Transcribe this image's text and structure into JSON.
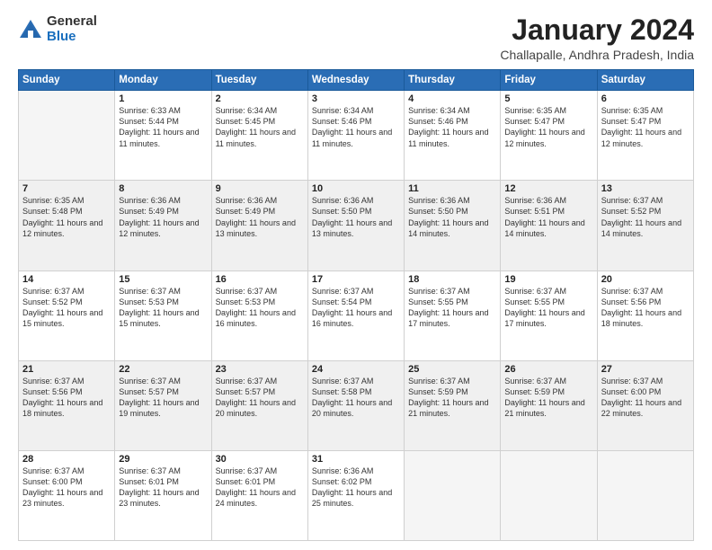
{
  "logo": {
    "general": "General",
    "blue": "Blue"
  },
  "header": {
    "month_year": "January 2024",
    "location": "Challapalle, Andhra Pradesh, India"
  },
  "days_of_week": [
    "Sunday",
    "Monday",
    "Tuesday",
    "Wednesday",
    "Thursday",
    "Friday",
    "Saturday"
  ],
  "weeks": [
    [
      {
        "day": "",
        "sunrise": "",
        "sunset": "",
        "daylight": "",
        "empty": true
      },
      {
        "day": "1",
        "sunrise": "Sunrise: 6:33 AM",
        "sunset": "Sunset: 5:44 PM",
        "daylight": "Daylight: 11 hours and 11 minutes."
      },
      {
        "day": "2",
        "sunrise": "Sunrise: 6:34 AM",
        "sunset": "Sunset: 5:45 PM",
        "daylight": "Daylight: 11 hours and 11 minutes."
      },
      {
        "day": "3",
        "sunrise": "Sunrise: 6:34 AM",
        "sunset": "Sunset: 5:46 PM",
        "daylight": "Daylight: 11 hours and 11 minutes."
      },
      {
        "day": "4",
        "sunrise": "Sunrise: 6:34 AM",
        "sunset": "Sunset: 5:46 PM",
        "daylight": "Daylight: 11 hours and 11 minutes."
      },
      {
        "day": "5",
        "sunrise": "Sunrise: 6:35 AM",
        "sunset": "Sunset: 5:47 PM",
        "daylight": "Daylight: 11 hours and 12 minutes."
      },
      {
        "day": "6",
        "sunrise": "Sunrise: 6:35 AM",
        "sunset": "Sunset: 5:47 PM",
        "daylight": "Daylight: 11 hours and 12 minutes."
      }
    ],
    [
      {
        "day": "7",
        "sunrise": "Sunrise: 6:35 AM",
        "sunset": "Sunset: 5:48 PM",
        "daylight": "Daylight: 11 hours and 12 minutes."
      },
      {
        "day": "8",
        "sunrise": "Sunrise: 6:36 AM",
        "sunset": "Sunset: 5:49 PM",
        "daylight": "Daylight: 11 hours and 12 minutes."
      },
      {
        "day": "9",
        "sunrise": "Sunrise: 6:36 AM",
        "sunset": "Sunset: 5:49 PM",
        "daylight": "Daylight: 11 hours and 13 minutes."
      },
      {
        "day": "10",
        "sunrise": "Sunrise: 6:36 AM",
        "sunset": "Sunset: 5:50 PM",
        "daylight": "Daylight: 11 hours and 13 minutes."
      },
      {
        "day": "11",
        "sunrise": "Sunrise: 6:36 AM",
        "sunset": "Sunset: 5:50 PM",
        "daylight": "Daylight: 11 hours and 14 minutes."
      },
      {
        "day": "12",
        "sunrise": "Sunrise: 6:36 AM",
        "sunset": "Sunset: 5:51 PM",
        "daylight": "Daylight: 11 hours and 14 minutes."
      },
      {
        "day": "13",
        "sunrise": "Sunrise: 6:37 AM",
        "sunset": "Sunset: 5:52 PM",
        "daylight": "Daylight: 11 hours and 14 minutes."
      }
    ],
    [
      {
        "day": "14",
        "sunrise": "Sunrise: 6:37 AM",
        "sunset": "Sunset: 5:52 PM",
        "daylight": "Daylight: 11 hours and 15 minutes."
      },
      {
        "day": "15",
        "sunrise": "Sunrise: 6:37 AM",
        "sunset": "Sunset: 5:53 PM",
        "daylight": "Daylight: 11 hours and 15 minutes."
      },
      {
        "day": "16",
        "sunrise": "Sunrise: 6:37 AM",
        "sunset": "Sunset: 5:53 PM",
        "daylight": "Daylight: 11 hours and 16 minutes."
      },
      {
        "day": "17",
        "sunrise": "Sunrise: 6:37 AM",
        "sunset": "Sunset: 5:54 PM",
        "daylight": "Daylight: 11 hours and 16 minutes."
      },
      {
        "day": "18",
        "sunrise": "Sunrise: 6:37 AM",
        "sunset": "Sunset: 5:55 PM",
        "daylight": "Daylight: 11 hours and 17 minutes."
      },
      {
        "day": "19",
        "sunrise": "Sunrise: 6:37 AM",
        "sunset": "Sunset: 5:55 PM",
        "daylight": "Daylight: 11 hours and 17 minutes."
      },
      {
        "day": "20",
        "sunrise": "Sunrise: 6:37 AM",
        "sunset": "Sunset: 5:56 PM",
        "daylight": "Daylight: 11 hours and 18 minutes."
      }
    ],
    [
      {
        "day": "21",
        "sunrise": "Sunrise: 6:37 AM",
        "sunset": "Sunset: 5:56 PM",
        "daylight": "Daylight: 11 hours and 18 minutes."
      },
      {
        "day": "22",
        "sunrise": "Sunrise: 6:37 AM",
        "sunset": "Sunset: 5:57 PM",
        "daylight": "Daylight: 11 hours and 19 minutes."
      },
      {
        "day": "23",
        "sunrise": "Sunrise: 6:37 AM",
        "sunset": "Sunset: 5:57 PM",
        "daylight": "Daylight: 11 hours and 20 minutes."
      },
      {
        "day": "24",
        "sunrise": "Sunrise: 6:37 AM",
        "sunset": "Sunset: 5:58 PM",
        "daylight": "Daylight: 11 hours and 20 minutes."
      },
      {
        "day": "25",
        "sunrise": "Sunrise: 6:37 AM",
        "sunset": "Sunset: 5:59 PM",
        "daylight": "Daylight: 11 hours and 21 minutes."
      },
      {
        "day": "26",
        "sunrise": "Sunrise: 6:37 AM",
        "sunset": "Sunset: 5:59 PM",
        "daylight": "Daylight: 11 hours and 21 minutes."
      },
      {
        "day": "27",
        "sunrise": "Sunrise: 6:37 AM",
        "sunset": "Sunset: 6:00 PM",
        "daylight": "Daylight: 11 hours and 22 minutes."
      }
    ],
    [
      {
        "day": "28",
        "sunrise": "Sunrise: 6:37 AM",
        "sunset": "Sunset: 6:00 PM",
        "daylight": "Daylight: 11 hours and 23 minutes."
      },
      {
        "day": "29",
        "sunrise": "Sunrise: 6:37 AM",
        "sunset": "Sunset: 6:01 PM",
        "daylight": "Daylight: 11 hours and 23 minutes."
      },
      {
        "day": "30",
        "sunrise": "Sunrise: 6:37 AM",
        "sunset": "Sunset: 6:01 PM",
        "daylight": "Daylight: 11 hours and 24 minutes."
      },
      {
        "day": "31",
        "sunrise": "Sunrise: 6:36 AM",
        "sunset": "Sunset: 6:02 PM",
        "daylight": "Daylight: 11 hours and 25 minutes."
      },
      {
        "day": "",
        "empty": true
      },
      {
        "day": "",
        "empty": true
      },
      {
        "day": "",
        "empty": true
      }
    ]
  ]
}
